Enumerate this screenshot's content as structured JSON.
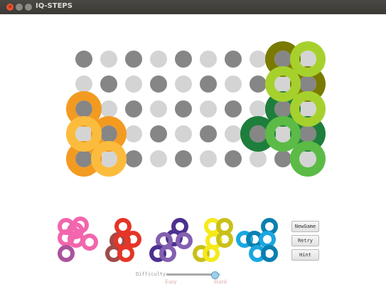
{
  "window": {
    "title": "IQ-STEPS",
    "controls": [
      "close",
      "minimize",
      "maximize"
    ]
  },
  "board": {
    "columns": 10,
    "rows": 5,
    "pegs_pattern": "checkerboard",
    "colors": {
      "peg_dark": "#868686",
      "peg_light": "#d4d4d4"
    },
    "placed_pieces": [
      {
        "name": "orange",
        "color": "#f39a21",
        "cells": [
          [
            0,
            2
          ],
          [
            0,
            4
          ],
          [
            1,
            3
          ]
        ]
      },
      {
        "name": "light-orange",
        "color": "#fbbc3d",
        "cells": [
          [
            0,
            3
          ],
          [
            1,
            4
          ]
        ]
      },
      {
        "name": "olive",
        "color": "#7a7a00",
        "cells": [
          [
            8,
            0
          ],
          [
            9,
            1
          ]
        ]
      },
      {
        "name": "dark-green",
        "color": "#1e7e3c",
        "cells": [
          [
            7,
            3
          ],
          [
            8,
            2
          ],
          [
            9,
            3
          ]
        ]
      },
      {
        "name": "green",
        "color": "#5bbb46",
        "cells": [
          [
            8,
            3
          ],
          [
            9,
            4
          ]
        ]
      },
      {
        "name": "lime",
        "color": "#a6d12d",
        "cells": [
          [
            8,
            1
          ],
          [
            9,
            0
          ],
          [
            9,
            2
          ]
        ]
      }
    ]
  },
  "tray": {
    "pieces": [
      {
        "name": "pink",
        "colors": [
          "#f266ad",
          "#a9549c"
        ]
      },
      {
        "name": "red",
        "colors": [
          "#e53527",
          "#a04a48"
        ]
      },
      {
        "name": "purple",
        "colors": [
          "#4c3090",
          "#8360b0"
        ]
      },
      {
        "name": "yellow",
        "colors": [
          "#f4ea1a",
          "#c9c019"
        ]
      },
      {
        "name": "blue",
        "colors": [
          "#1aa7e1",
          "#0a80b0"
        ]
      }
    ]
  },
  "buttons": {
    "new_game": "NewGame",
    "retry": "Retry",
    "hint": "Hint"
  },
  "difficulty": {
    "label": "Difficulty:",
    "value_fraction": 0.9,
    "min_label": "Easy",
    "max_label": "Hard"
  }
}
